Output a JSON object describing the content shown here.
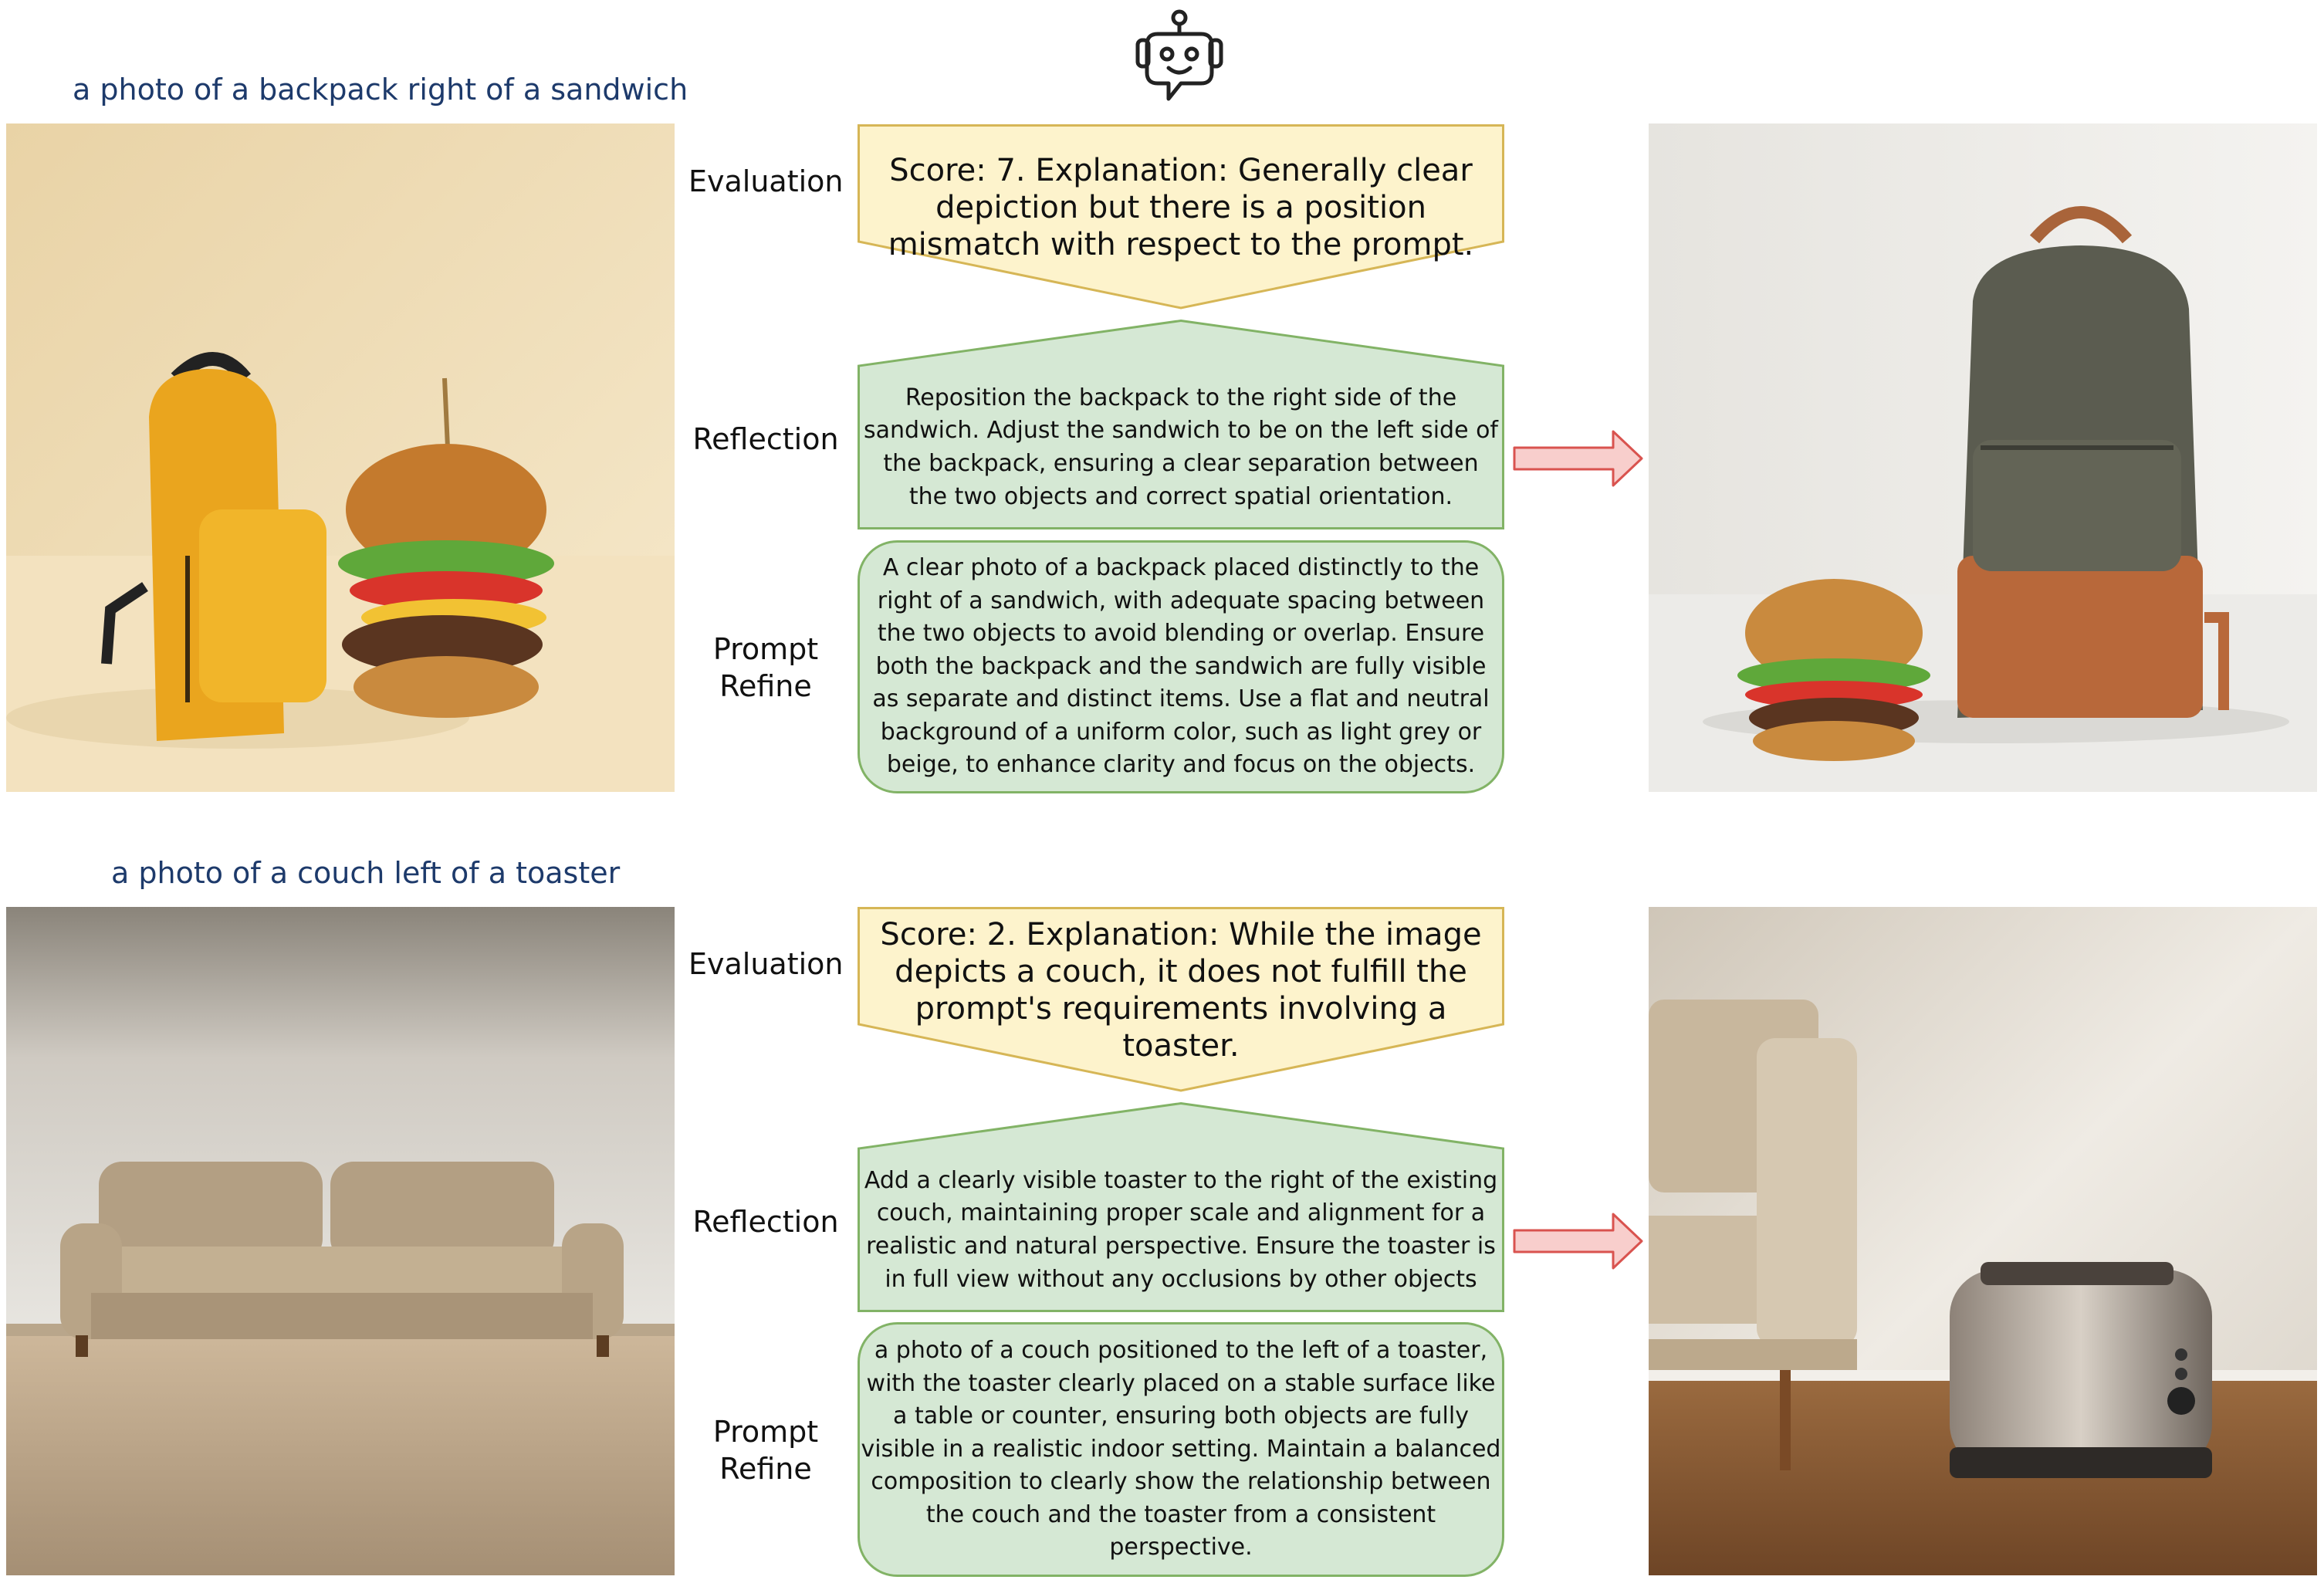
{
  "robot_icon": "robot-chat-icon",
  "arrow_icon": "right-arrow-icon",
  "colors": {
    "eval_fill": "#fdf3cc",
    "eval_stroke": "#d6b656",
    "green_fill": "#d5e8d4",
    "green_stroke": "#82b366",
    "arrow_fill": "#f8cecc",
    "arrow_stroke": "#d9534f",
    "prompt_text": "#1d3a6b"
  },
  "labels": {
    "evaluation": "Evaluation",
    "reflection": "Reflection",
    "refine_line1": "Prompt",
    "refine_line2": "Refine"
  },
  "rows": [
    {
      "prompt": "a photo of a backpack right of a sandwich",
      "evaluation": "Score: 7. Explanation: Generally clear depiction but there is a position mismatch with respect to the prompt.",
      "reflection": "Reposition the backpack to the right side of the sandwich. Adjust the sandwich to be on the left side of the backpack, ensuring a clear separation between the two objects and correct spatial orientation.",
      "prompt_refine": "A clear photo of a backpack placed distinctly to the right of a sandwich, with adequate spacing between the two objects to avoid blending or overlap. Ensure both the backpack and the sandwich are fully visible as separate and distinct items. Use a flat and neutral background of a uniform color, such as light grey or beige, to enhance clarity and focus on the objects."
    },
    {
      "prompt": "a photo of a couch left of a toaster",
      "evaluation": "Score: 2. Explanation: While the image depicts a couch, it does not fulfill the prompt's requirements involving a toaster.",
      "reflection": "Add a clearly visible toaster to the right of the existing couch, maintaining proper scale and alignment for a realistic and natural perspective. Ensure the toaster is in full view without any occlusions by other objects",
      "prompt_refine": "a photo of a couch positioned to the left of a toaster, with the toaster clearly placed on a stable surface like a table or counter, ensuring both objects are fully visible in a realistic indoor setting. Maintain a balanced composition to clearly show the relationship between the couch and the toaster from a consistent perspective."
    }
  ]
}
